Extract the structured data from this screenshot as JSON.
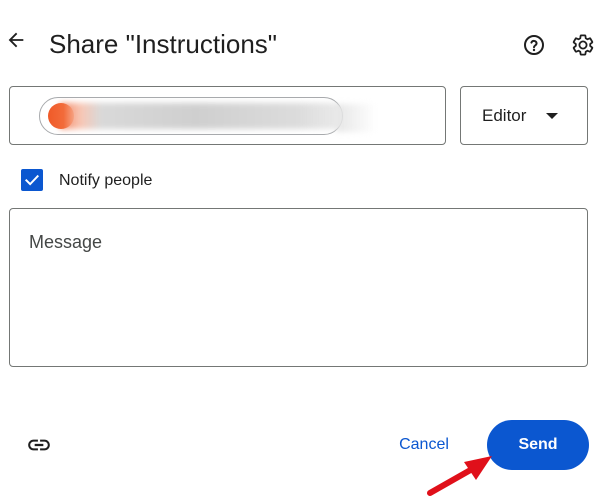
{
  "header": {
    "title": "Share \"Instructions\"",
    "back_icon": "arrow-back-icon",
    "help_icon": "help-circle-icon",
    "settings_icon": "gear-icon"
  },
  "recipients": {
    "chip_avatar_color": "#f05a28",
    "chip_text_redacted": true
  },
  "role": {
    "selected": "Editor"
  },
  "notify": {
    "label": "Notify people",
    "checked": true,
    "color": "#0b57d0"
  },
  "message": {
    "placeholder": "Message",
    "value": ""
  },
  "footer": {
    "link_icon": "link-icon",
    "cancel_label": "Cancel",
    "send_label": "Send"
  },
  "colors": {
    "accent": "#0b57d0",
    "annotation": "#e0101a"
  }
}
